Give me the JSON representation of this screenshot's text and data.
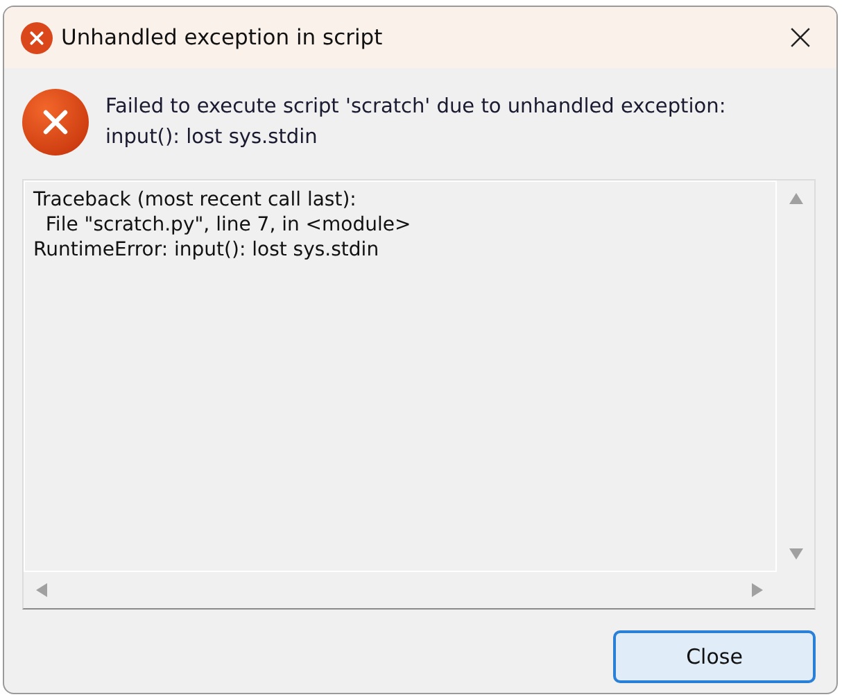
{
  "window": {
    "title": "Unhandled exception in script"
  },
  "message": [
    "Failed to execute script 'scratch' due to unhandled exception:",
    "input(): lost sys.stdin"
  ],
  "traceback": [
    "Traceback (most recent call last):",
    "  File \"scratch.py\", line 7, in <module>",
    "RuntimeError: input(): lost sys.stdin"
  ],
  "buttons": [
    {
      "label": "Close",
      "focused": true
    }
  ]
}
